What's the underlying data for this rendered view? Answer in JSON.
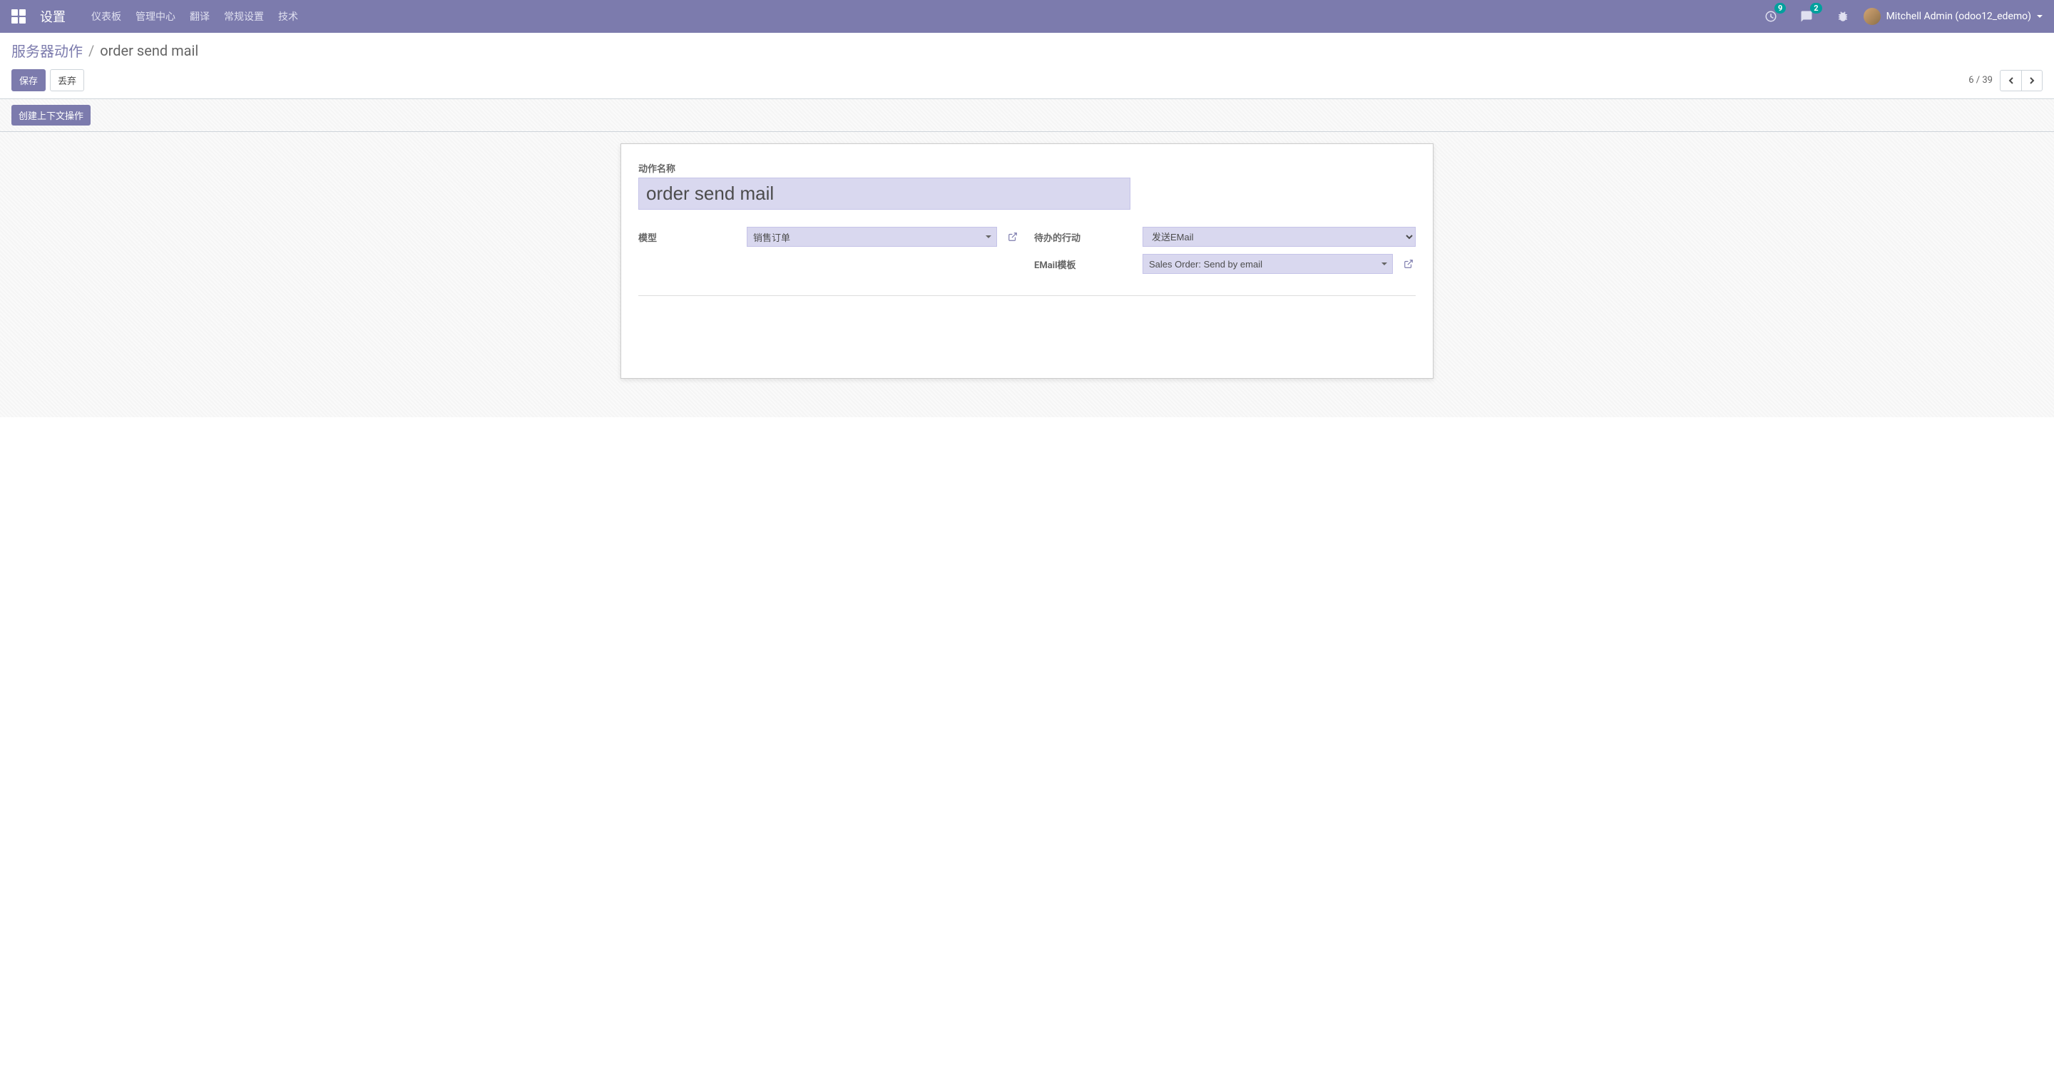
{
  "navbar": {
    "app_title": "设置",
    "menu_items": [
      "仪表板",
      "管理中心",
      "翻译",
      "常规设置",
      "技术"
    ],
    "notifications_count": "9",
    "messages_count": "2",
    "user_name": "Mitchell Admin (odoo12_edemo)"
  },
  "breadcrumb": {
    "parent": "服务器动作",
    "separator": "/",
    "current": "order send mail"
  },
  "buttons": {
    "save": "保存",
    "discard": "丢弃",
    "create_context_action": "创建上下文操作"
  },
  "pager": {
    "current": "6",
    "separator": " / ",
    "total": "39"
  },
  "form": {
    "action_name_label": "动作名称",
    "action_name_value": "order send mail",
    "model_label": "模型",
    "model_value": "销售订单",
    "todo_label": "待办的行动",
    "todo_value": "发送EMail",
    "email_template_label": "EMail模板",
    "email_template_value": "Sales Order: Send by email"
  }
}
